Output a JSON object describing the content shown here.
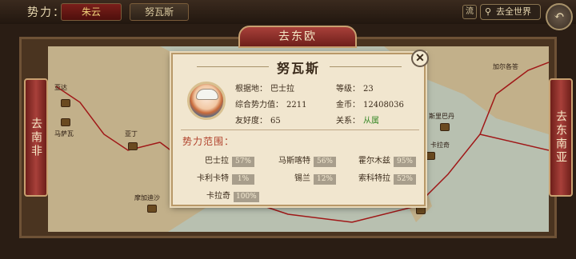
{
  "topbar": {
    "faction_label": "势力：",
    "tabs": [
      {
        "label": "朱云",
        "active": true
      },
      {
        "label": "努瓦斯",
        "active": false
      }
    ],
    "flow_label": "流",
    "world_button": "去全世界",
    "search_icon": "search-icon",
    "back_icon": "back-arrow-icon"
  },
  "map": {
    "banner_top": "去东欧",
    "banner_left": "去南非",
    "banner_right": "去东南亚",
    "labels": [
      "亚达",
      "马萨瓦",
      "亚丁",
      "摩加迪沙",
      "加尔各答",
      "斯里巴丹",
      "卡拉奇"
    ]
  },
  "popup": {
    "title": "努瓦斯",
    "base_label": "根据地：",
    "base_value": "巴士拉",
    "level_label": "等级：",
    "level_value": "23",
    "power_label": "综合势力值：",
    "power_value": "2211",
    "gold_label": "金币：",
    "gold_value": "12408036",
    "friend_label": "友好度：",
    "friend_value": "65",
    "relation_label": "关系：",
    "relation_value": "从属",
    "sphere_title": "势力范围：",
    "territories": [
      {
        "name": "巴士拉",
        "pct": "57%"
      },
      {
        "name": "马斯喀特",
        "pct": "56%"
      },
      {
        "name": "霍尔木兹",
        "pct": "95%"
      },
      {
        "name": "卡利卡特",
        "pct": "1%"
      },
      {
        "name": "锡兰",
        "pct": "12%"
      },
      {
        "name": "索科特拉",
        "pct": "52%"
      },
      {
        "name": "卡拉奇",
        "pct": "100%"
      }
    ]
  },
  "colors": {
    "accent_red": "#a8403a",
    "relation_green": "#3a8a2a",
    "parchment": "#f1e6cf"
  }
}
